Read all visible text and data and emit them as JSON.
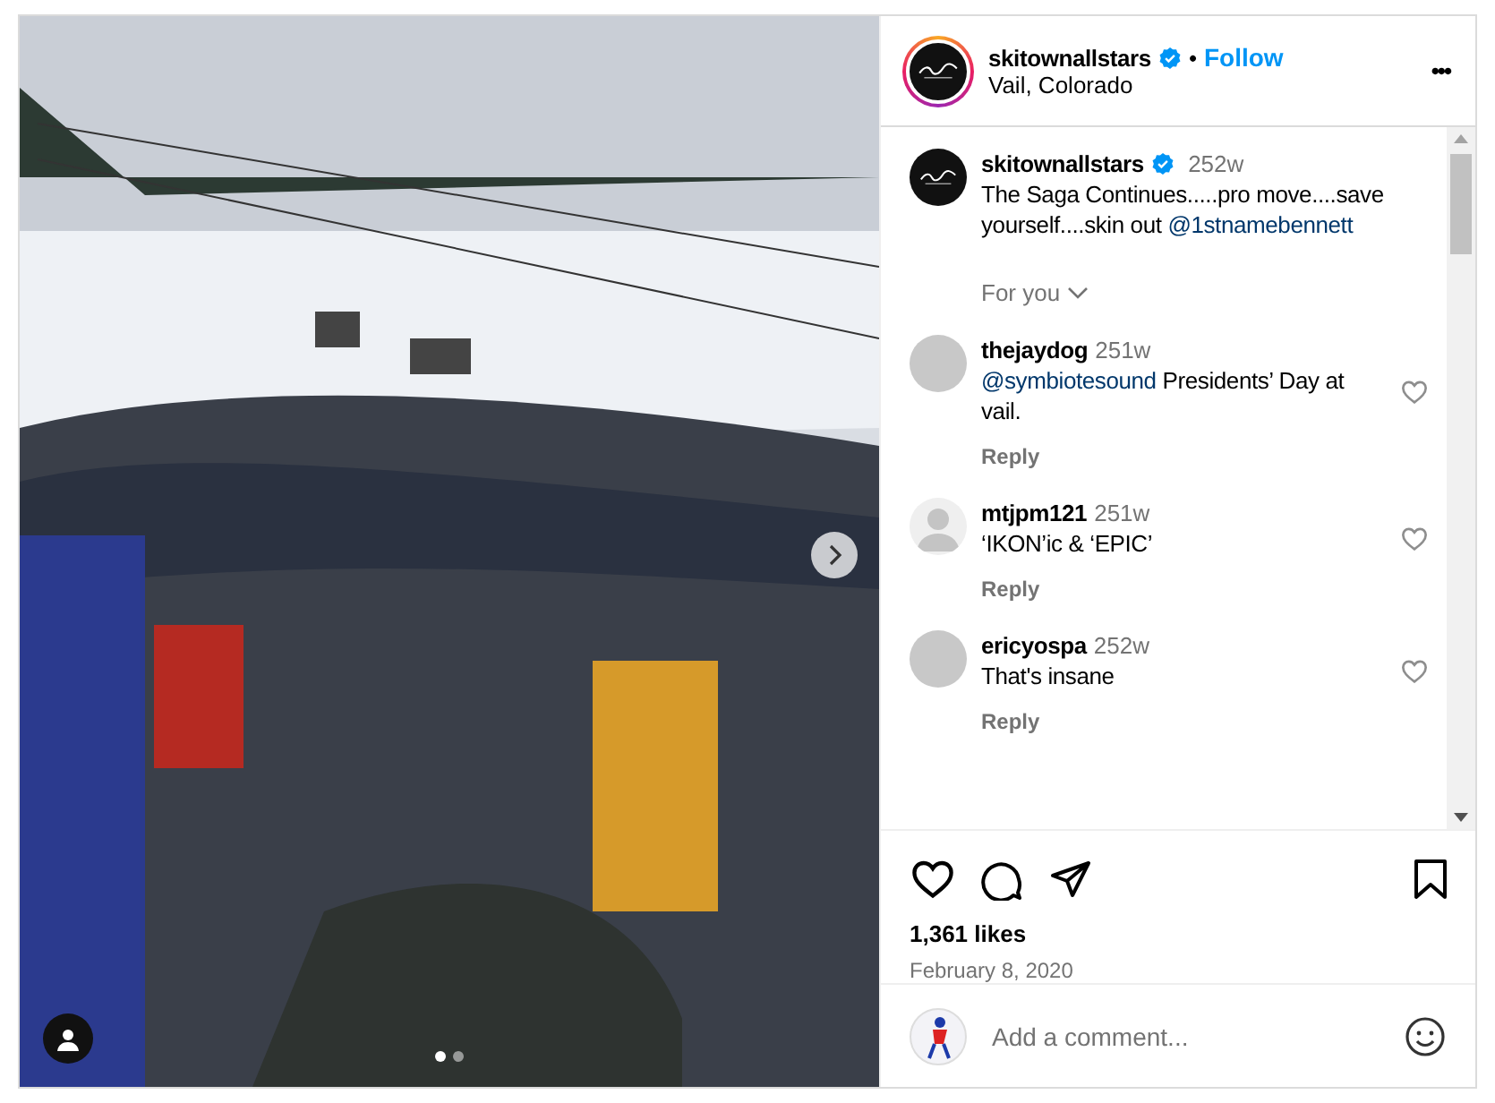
{
  "post": {
    "username": "skitownallstars",
    "verified": true,
    "location": "Vail, Colorado",
    "follow": "Follow",
    "separator": "•",
    "more": "•••"
  },
  "media": {
    "dots": [
      {
        "selected": true
      },
      {
        "selected": false
      }
    ]
  },
  "caption": {
    "username": "skitownallstars",
    "verified": true,
    "time": "252w",
    "text": "The Saga Continues.....pro move....save yourself....skin out",
    "mention": "@1stnamebennett"
  },
  "for_you": "For you",
  "comments": [
    {
      "username": "thejaydog",
      "time": "251w",
      "mention": "@symbiotesound",
      "text": "Presidents’ Day at vail.",
      "reply": "Reply",
      "kind": "photo",
      "liked": false
    },
    {
      "username": "mtjpm121",
      "time": "251w",
      "text": "‘IKON’ic & ‘EPIC’",
      "reply": "Reply",
      "kind": "default",
      "liked": false
    },
    {
      "username": "ericyospa",
      "time": "252w",
      "text": "That's insane",
      "reply": "Reply",
      "kind": "photo",
      "liked": false
    }
  ],
  "actions": {
    "liked": false,
    "saved": false
  },
  "likes": "1,361 likes",
  "date": "February 8, 2020",
  "comment_field": {
    "placeholder": "Add a comment..."
  }
}
